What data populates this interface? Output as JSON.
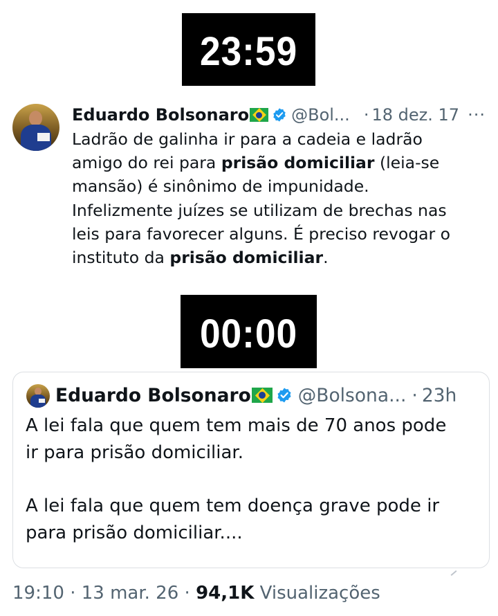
{
  "first_clock": {
    "time": "23:59"
  },
  "original_tweet": {
    "author_name": "Eduardo Bolsonaro",
    "handle": "@Bol...",
    "separator": "·",
    "date": "18 dez. 17",
    "more": "···",
    "lines": [
      [
        "Ladrão de galinha ir para a cadeia e ladrão"
      ],
      [
        "amigo do rei para ",
        {
          "bold": "prisão domiciliar"
        },
        " (leia-se"
      ],
      [
        "mansão) é sinônimo de impunidade."
      ],
      [
        "Infelizmente juízes se utilizam de brechas nas"
      ],
      [
        "leis para favorecer alguns. É preciso revogar o"
      ],
      [
        "instituto da ",
        {
          "bold": "prisão domiciliar"
        },
        "."
      ]
    ]
  },
  "second_clock": {
    "time": "00:00"
  },
  "quoted_tweet": {
    "author_name": "Eduardo Bolsonaro",
    "handle": "@Bolsona...",
    "separator": "·",
    "age": "23h",
    "paragraph1": [
      "A lei fala que quem tem mais de 70 anos pode",
      "ir para prisão domiciliar."
    ],
    "paragraph2": [
      "A lei fala que quem tem doença grave pode ir",
      "para prisão domiciliar...."
    ]
  },
  "footer": {
    "time": "19:10",
    "sep": "·",
    "date": "13 mar. 26",
    "views_count": "94,1K",
    "views_label": "Visualizações"
  },
  "colors": {
    "text": "#0f1419",
    "muted": "#536471",
    "verified": "#1d9bf0",
    "clock_bg": "#000000",
    "clock_text": "#ffffff"
  },
  "icons": {
    "flag": "brazil-flag-icon",
    "verified": "verified-badge-icon",
    "more": "more-options-icon"
  }
}
